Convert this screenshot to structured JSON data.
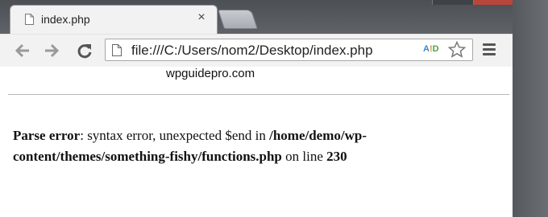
{
  "tab": {
    "title": "index.php",
    "close_glyph": "×"
  },
  "toolbar": {
    "url": "file:///C:/Users/nom2/Desktop/index.php",
    "extension": {
      "a": "A",
      "l": "!",
      "d": "D"
    }
  },
  "page": {
    "watermark": "wpguidepro.com",
    "error": {
      "label": "Parse error",
      "message": ": syntax error, unexpected $end in ",
      "path": "/home/demo/wp-content/themes/something-fishy/functions.php",
      "line_prefix": " on line ",
      "line": "230"
    }
  },
  "icons": [
    "page-icon",
    "close-icon",
    "back-arrow-icon",
    "forward-arrow-icon",
    "reload-icon",
    "star-icon",
    "menu-icon"
  ]
}
